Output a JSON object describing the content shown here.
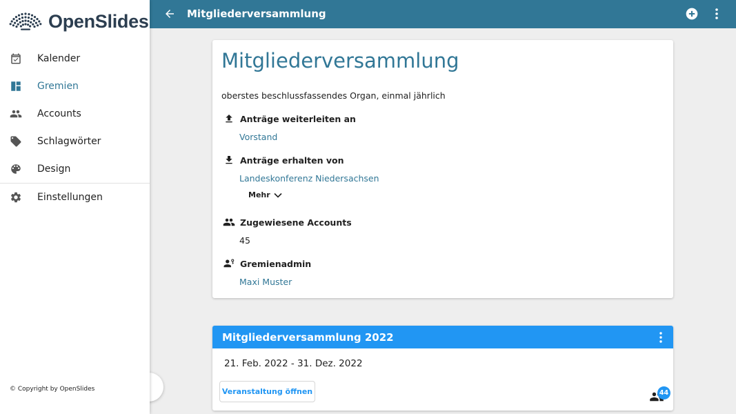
{
  "app": {
    "name": "OpenSlides"
  },
  "sidebar": {
    "items": [
      {
        "label": "Kalender",
        "icon": "calendar-icon",
        "active": false
      },
      {
        "label": "Gremien",
        "icon": "dashboard-icon",
        "active": true
      },
      {
        "label": "Accounts",
        "icon": "people-icon",
        "active": false
      },
      {
        "label": "Schlagwörter",
        "icon": "tag-icon",
        "active": false
      },
      {
        "label": "Design",
        "icon": "palette-icon",
        "active": false
      },
      {
        "label": "Einstellungen",
        "icon": "gear-icon",
        "active": false
      }
    ],
    "copyright": "© Copyright by OpenSlides"
  },
  "topbar": {
    "title": "Mitgliederversammlung"
  },
  "committee": {
    "title": "Mitgliederversammlung",
    "description": "oberstes beschlussfassendes Organ, einmal jährlich",
    "forward_label": "Anträge weiterleiten an",
    "forward_value": "Vorstand",
    "receive_label": "Anträge erhalten von",
    "receive_value": "Landeskonferenz Niedersachsen",
    "more_label": "Mehr",
    "accounts_label": "Zugewiesene Accounts",
    "accounts_value": "45",
    "admin_label": "Gremienadmin",
    "admin_value": "Maxi Muster"
  },
  "meeting": {
    "title": "Mitgliederversammlung 2022",
    "dates": "21. Feb. 2022 - 31. Dez. 2022",
    "open_label": "Veranstaltung öffnen",
    "participant_count": "44"
  },
  "colors": {
    "primary": "#317796",
    "accent": "#2196f3",
    "background": "#eeeeee"
  }
}
